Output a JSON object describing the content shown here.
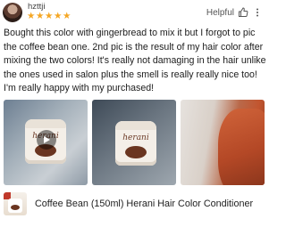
{
  "review": {
    "username": "hzttji",
    "rating_stars": "★★★★★",
    "rating": 5,
    "star_color": "#f5a623",
    "helpful_label": "Helpful",
    "text": "Bought this color with gingerbread to mix it but I forgot to pic the coffee bean one. 2nd pic is the result of my hair color after mixing the two colors! It's really not damaging in the hair unlike the ones used in salon plus the smell is really really nice too! I'm really happy with my purchased!"
  },
  "photos": {
    "jar_brand": "herani"
  },
  "product": {
    "title": "Coffee Bean (150ml) Herani Hair Color Conditioner"
  }
}
